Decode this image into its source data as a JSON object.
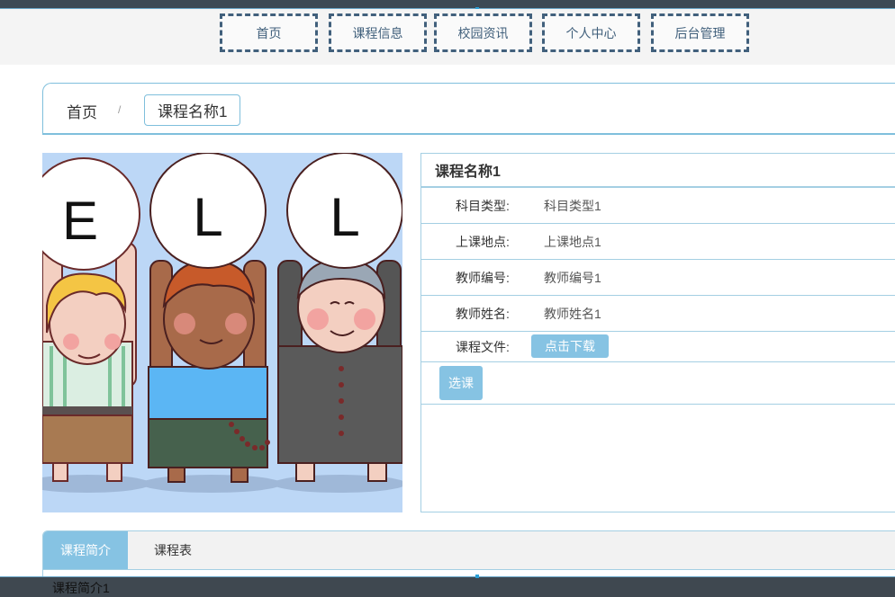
{
  "nav": {
    "items": [
      {
        "label": "首页"
      },
      {
        "label": "课程信息"
      },
      {
        "label": "校园资讯"
      },
      {
        "label": "个人中心"
      },
      {
        "label": "后台管理"
      }
    ]
  },
  "breadcrumb": {
    "home": "首页",
    "separator": "/",
    "current": "课程名称1"
  },
  "photo": {
    "letters": [
      "E",
      "L",
      "L"
    ]
  },
  "course": {
    "title": "课程名称1",
    "fields": [
      {
        "label": "科目类型:",
        "value": "科目类型1"
      },
      {
        "label": "上课地点:",
        "value": "上课地点1"
      },
      {
        "label": "教师编号:",
        "value": "教师编号1"
      },
      {
        "label": "教师姓名:",
        "value": "教师姓名1"
      }
    ],
    "file_label": "课程文件:",
    "download_label": "点击下载",
    "select_label": "选课"
  },
  "tabs": {
    "items": [
      {
        "label": "课程简介"
      },
      {
        "label": "课程表"
      }
    ],
    "content": "课程简介1"
  },
  "colors": {
    "accent": "#86c3e3",
    "border": "#a4cfe3",
    "nav_border": "#41607c"
  }
}
